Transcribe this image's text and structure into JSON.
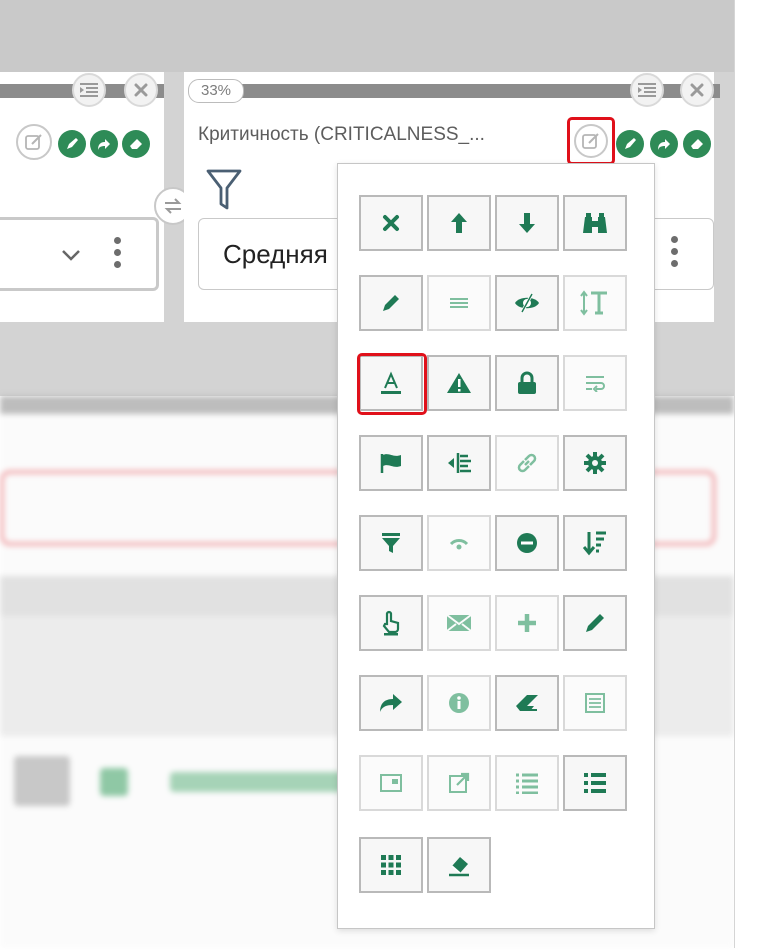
{
  "widget_left": {
    "dropdown_value": ""
  },
  "widget_right": {
    "progress_label": "33%",
    "progress_value": 0.33,
    "title": "Критичность (CRITICALNESS_...",
    "dropdown_value": "Средняя"
  },
  "icon_picker": {
    "rows": [
      [
        "close-icon",
        "arrow-up-icon",
        "arrow-down-icon",
        "binoculars-icon"
      ],
      [
        "pencil-icon",
        "list-lines-icon",
        "eye-slash-icon",
        "text-height-icon"
      ],
      [
        "font-color-icon",
        "warning-icon",
        "lock-icon",
        "wrap-text-icon"
      ],
      [
        "flag-icon",
        "indent-icon",
        "link-icon",
        "gear-icon"
      ],
      [
        "filter-icon",
        "wifi-signal-icon",
        "minus-circle-icon",
        "sort-amount-icon"
      ],
      [
        "hand-pointer-icon",
        "envelope-icon",
        "plus-icon",
        "pen-icon"
      ],
      [
        "share-arrow-icon",
        "info-circle-icon",
        "eraser-icon",
        "list-alt-icon"
      ],
      [
        "window-icon",
        "external-link-icon",
        "list-icon",
        "list-bold-icon"
      ],
      [
        "grid-dots-icon",
        "eraser-clear-icon"
      ]
    ],
    "selected": "font-color-icon"
  },
  "colors": {
    "accent_green": "#1f7a55",
    "light_green": "#7fbf9f",
    "highlight_red": "#e0101a"
  }
}
